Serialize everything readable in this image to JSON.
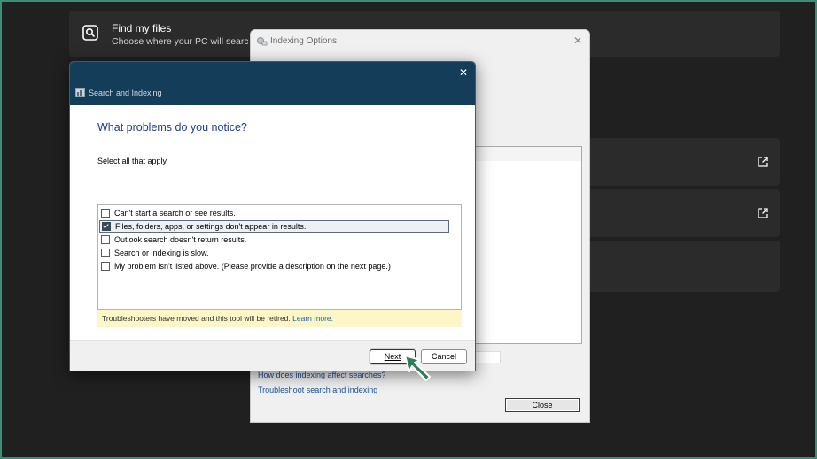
{
  "settings": {
    "find_title": "Find my files",
    "find_subtitle": "Choose where your PC will search f"
  },
  "indexing_window": {
    "title": "Indexing Options",
    "link1": "How does indexing affect searches?",
    "link2": "Troubleshoot search and indexing",
    "close_label": "Close"
  },
  "dialog": {
    "title": "Search and Indexing",
    "question": "What problems do you notice?",
    "instruction": "Select all that apply.",
    "options": [
      {
        "label": "Can't start a search or see results.",
        "checked": false
      },
      {
        "label": "Files, folders, apps, or settings don't appear in results.",
        "checked": true
      },
      {
        "label": "Outlook search doesn't return results.",
        "checked": false
      },
      {
        "label": "Search or indexing is slow.",
        "checked": false
      },
      {
        "label": "My problem isn't listed above. (Please provide a description on the next page.)",
        "checked": false
      }
    ],
    "note_text": "Troubleshooters have moved and this tool will be retired.",
    "note_link": "Learn more.",
    "next_label": "Next",
    "cancel_label": "Cancel"
  },
  "colors": {
    "dialog_header": "#143d59",
    "question_text": "#1e3d8f",
    "note_background": "#fdf6c7",
    "cursor_fill": "#2e7d5b"
  },
  "icons": {
    "search": "search-icon",
    "external_link": "external-link-icon",
    "close": "close-icon",
    "cursor": "cursor-arrow-icon"
  }
}
